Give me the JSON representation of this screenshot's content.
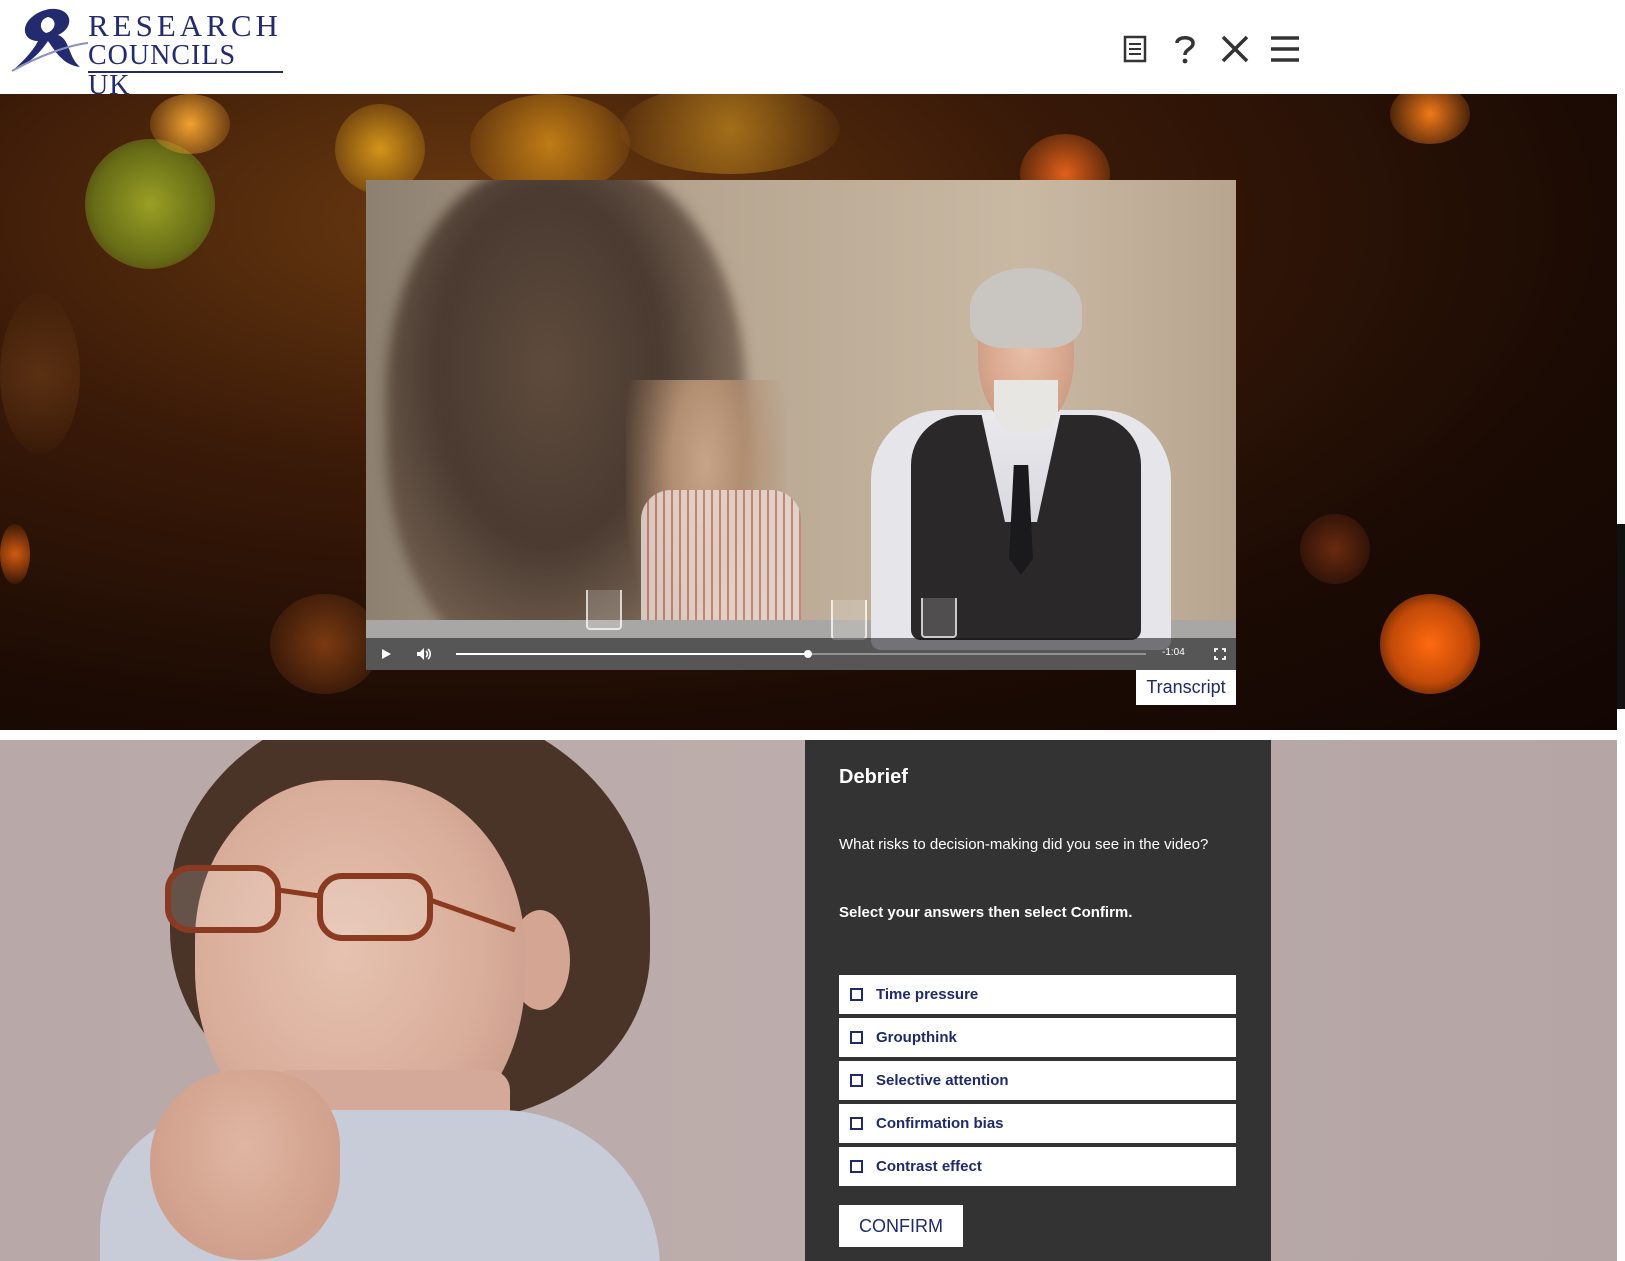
{
  "header": {
    "logo": {
      "line1": "RESEARCH",
      "line2": "COUNCILS UK"
    },
    "icons": [
      "document-icon",
      "help-icon",
      "close-icon",
      "menu-icon"
    ]
  },
  "video": {
    "time_remaining": "-1:04",
    "progress": 0.51
  },
  "transcript_label": "Transcript",
  "debrief": {
    "title": "Debrief",
    "question": "What risks to decision-making did you see in the video?",
    "instruction": "Select your answers then select Confirm.",
    "options": [
      {
        "label": "Time pressure",
        "checked": false
      },
      {
        "label": "Groupthink",
        "checked": false
      },
      {
        "label": "Selective attention",
        "checked": false
      },
      {
        "label": "Confirmation bias",
        "checked": false
      },
      {
        "label": "Contrast effect",
        "checked": false
      }
    ],
    "confirm_label": "CONFIRM"
  },
  "colors": {
    "brand_navy": "#1f2a6b",
    "panel_bg": "#333333",
    "hero_bg": "#1c0b04"
  }
}
